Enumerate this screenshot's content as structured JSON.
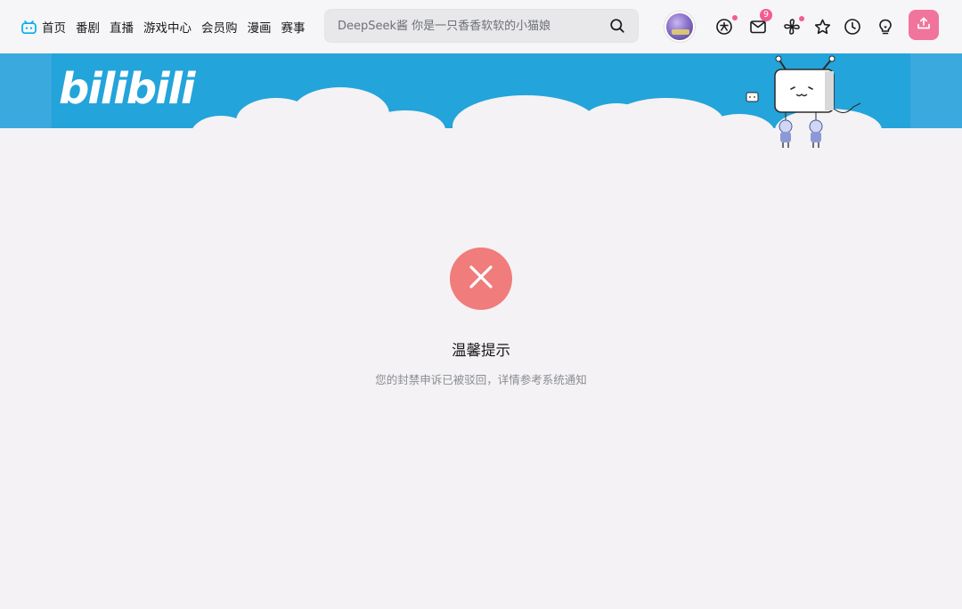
{
  "nav": {
    "items": [
      {
        "label": "首页",
        "icon": "bilibili-tv-icon"
      },
      {
        "label": "番剧"
      },
      {
        "label": "直播"
      },
      {
        "label": "游戏中心"
      },
      {
        "label": "会员购"
      },
      {
        "label": "漫画"
      },
      {
        "label": "赛事"
      }
    ]
  },
  "search": {
    "placeholder": "DeepSeek酱 你是一只香香软软的小猫娘",
    "icon": "search-icon"
  },
  "toolbar": {
    "avatar": "user-avatar",
    "icons": [
      "big-vip-icon",
      "message-icon",
      "dynamic-icon",
      "favorite-icon",
      "history-icon",
      "creation-icon"
    ],
    "message_badge": "9",
    "upload_icon": "upload-icon"
  },
  "banner": {
    "logo_text": "bilibili"
  },
  "notice": {
    "icon": "close-icon",
    "title": "温馨提示",
    "description": "您的封禁申诉已被驳回，详情参考系统通知"
  },
  "colors": {
    "accent_pink": "#f0749b",
    "banner_blue": "#23a4da",
    "error_red": "#f07c7c",
    "badge_pink": "#f25d8e"
  }
}
